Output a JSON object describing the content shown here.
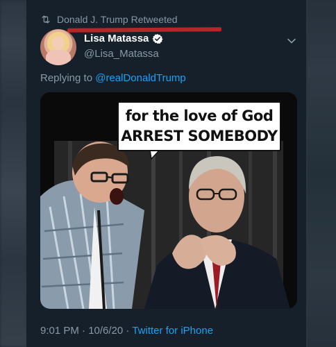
{
  "retweet": {
    "icon": "retweet-icon",
    "text": "Donald J. Trump Retweeted"
  },
  "tweet": {
    "display_name": "Lisa Matassa",
    "verified_icon": "verified-badge-icon",
    "handle": "@Lisa_Matassa",
    "replying_prefix": "Replying to ",
    "replying_to": "@realDonaldTrump",
    "meme_line1": "for the love of God",
    "meme_line2": "ARREST SOMEBODY",
    "time": "9:01 PM · 10/6/20",
    "separator": " · ",
    "source": "Twitter for iPhone"
  },
  "colors": {
    "background": "#15202b",
    "secondary_text": "#8899a6",
    "link": "#1da1f2",
    "highlight_underline": "#b3262a"
  }
}
